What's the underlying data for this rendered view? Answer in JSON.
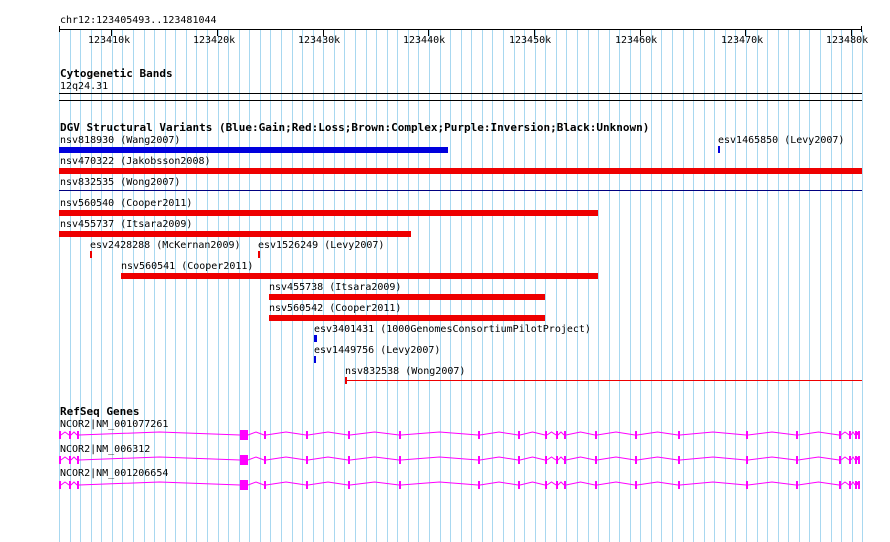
{
  "locus": "chr12:123405493..123481044",
  "ruler": {
    "tick_labels": [
      "123410k",
      "123420k",
      "123430k",
      "123440k",
      "123450k",
      "123460k",
      "123470k",
      "123480k"
    ]
  },
  "cytoband": {
    "title": "Cytogenetic Bands",
    "band": "12q24.31"
  },
  "dgv": {
    "title": "DGV Structural Variants (Blue:Gain;Red:Loss;Brown:Complex;Purple:Inversion;Black:Unknown)",
    "variants": [
      {
        "label": "nsv818930 (Wang2007)",
        "color": "#0000dd"
      },
      {
        "label": "esv1465850 (Levy2007)",
        "color": "#0000dd"
      },
      {
        "label": "nsv470322 (Jakobsson2008)",
        "color": "#ee0000"
      },
      {
        "label": "nsv832535 (Wong2007)",
        "color": "#000080"
      },
      {
        "label": "nsv560540 (Cooper2011)",
        "color": "#ee0000"
      },
      {
        "label": "nsv455737 (Itsara2009)",
        "color": "#ee0000"
      },
      {
        "label": "esv2428288 (McKernan2009)",
        "color": "#ee0000"
      },
      {
        "label": "esv1526249 (Levy2007)",
        "color": "#ee0000"
      },
      {
        "label": "nsv560541 (Cooper2011)",
        "color": "#ee0000"
      },
      {
        "label": "nsv455738 (Itsara2009)",
        "color": "#ee0000"
      },
      {
        "label": "nsv560542 (Cooper2011)",
        "color": "#ee0000"
      },
      {
        "label": "esv3401431 (1000GenomesConsortiumPilotProject)",
        "color": "#0000dd"
      },
      {
        "label": "esv1449756 (Levy2007)",
        "color": "#0000dd"
      },
      {
        "label": "nsv832538 (Wong2007)",
        "color": "#ee0000"
      }
    ]
  },
  "refseq": {
    "title": "RefSeq Genes",
    "genes": [
      {
        "label": "NCOR2|NM_001077261"
      },
      {
        "label": "NCOR2|NM_006312"
      },
      {
        "label": "NCOR2|NM_001206654"
      }
    ]
  },
  "colors": {
    "grid": "#a8d8f0",
    "gene": "#ff00ff",
    "loss": "#ee0000",
    "gain": "#0000dd"
  }
}
